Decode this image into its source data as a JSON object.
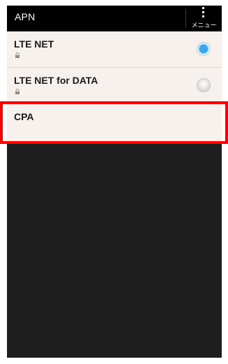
{
  "action_bar": {
    "title": "APN",
    "menu_label": "メニュー"
  },
  "apn_list": [
    {
      "name": "LTE NET",
      "locked": true,
      "selected": true
    },
    {
      "name": "LTE NET for DATA",
      "locked": true,
      "selected": false
    },
    {
      "name": "CPA",
      "locked": false,
      "selected": null
    }
  ],
  "colors": {
    "action_bar": "#000000",
    "list_background": "#f6f1ed",
    "radio_selected": "#39a8ea",
    "empty_area": "#1e1e1e",
    "highlight_box": "#ff0000"
  },
  "icons": [
    "lock-icon",
    "overflow-menu-icon",
    "radio-button"
  ]
}
